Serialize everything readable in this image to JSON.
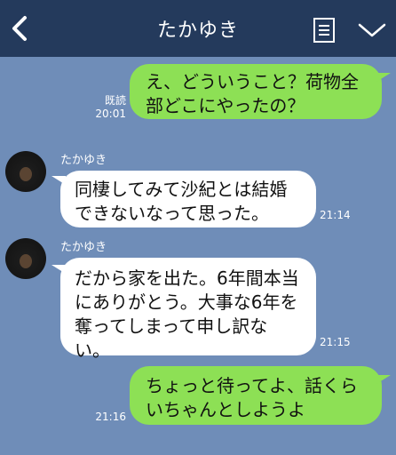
{
  "header": {
    "title": "たかゆき",
    "back_icon": "chevron-left-icon",
    "menu_icon": "note-icon",
    "expand_icon": "chevron-down-icon",
    "bg_color": "#243a5c"
  },
  "chat": {
    "bg_color": "#6f8db8",
    "messages": [
      {
        "sender": "me",
        "text": "え、どういうこと？荷物全部どこにやったの？",
        "read_label": "既読",
        "time": "20:01"
      },
      {
        "sender": "たかゆき",
        "text": "同棲してみて沙紀とは結婚できないなって思った。",
        "time": "21:14"
      },
      {
        "sender": "たかゆき",
        "text": "だから家を出た。6年間本当にありがとう。大事な6年を奪ってしまって申し訳ない。",
        "time": "21:15"
      },
      {
        "sender": "me",
        "text": "ちょっと待ってよ、話くらいちゃんとしようよ",
        "time": "21:16"
      }
    ]
  }
}
